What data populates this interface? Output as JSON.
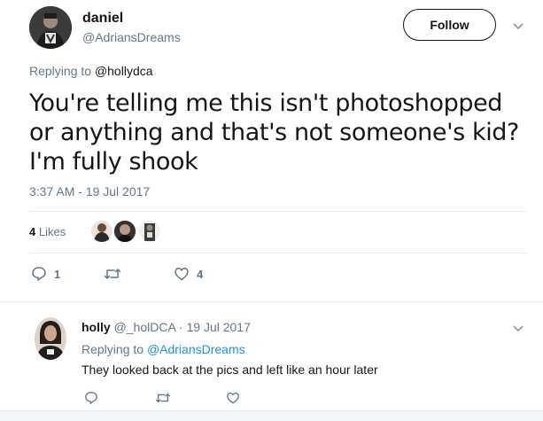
{
  "tweet": {
    "author_name": "daniel",
    "author_handle": "@AdriansDreams",
    "follow_label": "Follow",
    "replying_prefix": "Replying to ",
    "replying_to": "@hollydca",
    "text": "You're telling me this isn't photoshopped or anything and that's not someone's kid? I'm fully shook",
    "timestamp": "3:37 AM - 19 Jul 2017",
    "likes_count": "4",
    "likes_label": " Likes",
    "actions": {
      "reply_icon": "reply-icon",
      "reply_count": "1",
      "retweet_icon": "retweet-icon",
      "like_icon": "heart-icon",
      "like_count": "4"
    }
  },
  "reply": {
    "author_name": "holly",
    "author_handle": "@_holDCA",
    "separator": " · ",
    "date": "19 Jul 2017",
    "replying_prefix": "Replying to ",
    "replying_to": "@AdriansDreams",
    "text": "They looked back at the pics and left like an hour later"
  },
  "colors": {
    "text_primary": "#14171a",
    "text_secondary": "#657786",
    "link": "#1b95e0",
    "divider": "#e6ecf0",
    "background": "#ffffff"
  }
}
